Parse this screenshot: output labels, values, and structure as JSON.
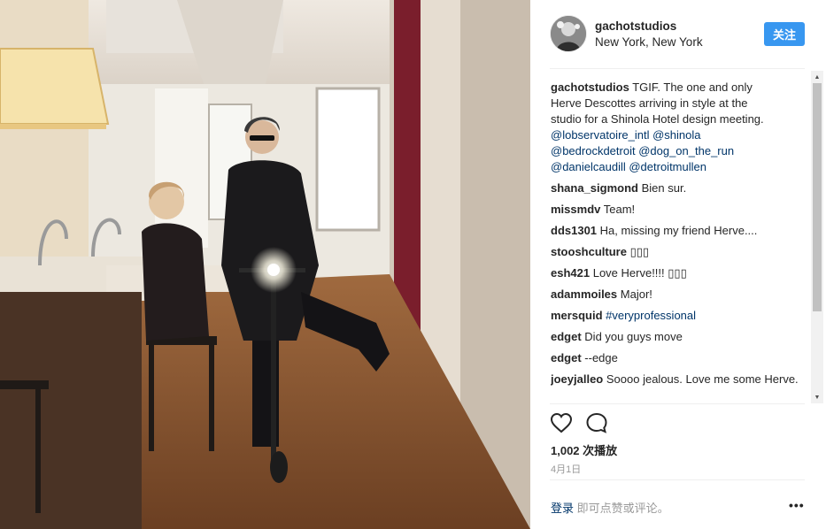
{
  "post": {
    "username": "gachotstudios",
    "location": "New York, New York",
    "follow_label": "关注"
  },
  "caption": {
    "user": "gachotstudios",
    "lines": [
      "TGIF. The one and only",
      "Herve Descottes arriving in style at the",
      "studio for a Shinola Hotel design meeting."
    ],
    "mentions_lines": [
      "@lobservatoire_intl @shinola",
      "@bedrockdetroit @dog_on_the_run",
      "@danielcaudill @detroitmullen"
    ]
  },
  "comments": [
    {
      "user": "shana_sigmond",
      "text": "Bien sur."
    },
    {
      "user": "missmdv",
      "text": "Team!"
    },
    {
      "user": "dds1301",
      "text": "Ha, missing my friend Herve...."
    },
    {
      "user": "stooshculture",
      "text": "▯▯▯"
    },
    {
      "user": "esh421",
      "text": "Love Herve!!!! ▯▯▯"
    },
    {
      "user": "adammoiles",
      "text": "Major!"
    },
    {
      "user": "mersquid",
      "text": "#veryprofessional"
    },
    {
      "user": "edget",
      "text": "Did you guys move"
    },
    {
      "user": "edget",
      "text": "--edge"
    },
    {
      "user": "joeyjalleo",
      "text": "Soooo jealous. Love me some Herve."
    }
  ],
  "actions": {
    "views": "1,002 次播放",
    "date": "4月1日"
  },
  "footer": {
    "login": "登录",
    "rest": " 即可点赞或评论。",
    "more": "•••"
  },
  "icons": {
    "like": "heart-icon",
    "comment": "speech-bubble-icon",
    "more": "ellipsis-icon"
  },
  "colors": {
    "follow_button": "#3897f0",
    "mention_link": "#003569",
    "muted_text": "#999999"
  }
}
